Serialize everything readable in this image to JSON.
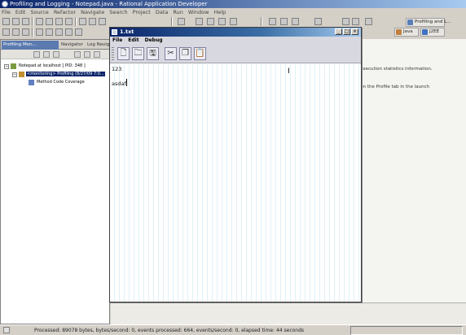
{
  "main_window": {
    "title": "Profiling and Logging - Notepad.java - Rational Application Developer",
    "menu": [
      "File",
      "Edit",
      "Source",
      "Refactor",
      "Navigate",
      "Search",
      "Project",
      "Data",
      "Run",
      "Window",
      "Help"
    ]
  },
  "perspectives": {
    "items": [
      {
        "label": "Profiling and L..."
      },
      {
        "label": "Java"
      },
      {
        "label": "J2EE"
      }
    ]
  },
  "left_view": {
    "tabs": [
      {
        "label": "Profiling Mon..."
      },
      {
        "label": "Navigator"
      },
      {
        "label": "Log Navig..."
      }
    ],
    "tree": [
      {
        "label": "Notepad at localhost [ PID: 348 ]",
        "level": 0,
        "expanded": true
      },
      {
        "label": "<monitoring> Profiling (8/27/09 7:0...",
        "level": 1,
        "expanded": true,
        "selected": true
      },
      {
        "label": "Method Code Coverage",
        "level": 2
      }
    ]
  },
  "editor_background": {
    "line1": "...execution statistics information.",
    "line2": "...on the Profile tab in the launch"
  },
  "child_window": {
    "title": "1.txt",
    "menu": [
      "File",
      "Edit",
      "Debug"
    ],
    "toolbar": [
      {
        "name": "new-icon",
        "glyph": "🗋"
      },
      {
        "name": "open-icon",
        "glyph": "🗀"
      },
      {
        "name": "save-icon",
        "glyph": "🖫"
      },
      {
        "name": "cut-icon",
        "glyph": "✂"
      },
      {
        "name": "copy-icon",
        "glyph": "❐"
      },
      {
        "name": "paste-icon",
        "glyph": "📋"
      }
    ],
    "text_lines": [
      "123",
      "asdaf"
    ],
    "window_controls": {
      "minimize": "_",
      "maximize": "□",
      "close": "×"
    }
  },
  "status": {
    "text": "Processed: 89078 bytes, bytes/second: 0, events processed: 664, events/second: 0, elapsed time: 44 seconds"
  },
  "colors": {
    "title_active": "#0a246a",
    "selection": "#0a246a",
    "tab_active": "#5a7ab0",
    "textarea_stripe": "#e0f0f6"
  }
}
